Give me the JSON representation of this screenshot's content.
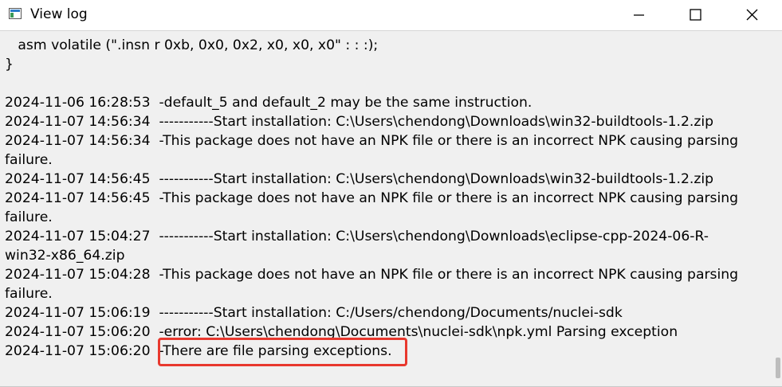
{
  "window": {
    "title": "View log",
    "icons": {
      "app": "window-app-icon",
      "minimize": "minimize-icon",
      "maximize": "maximize-icon",
      "close": "close-icon"
    }
  },
  "log": {
    "lines": [
      "   asm volatile (\".insn r 0xb, 0x0, 0x2, x0, x0, x0\" : : :);",
      "}",
      "",
      "2024-11-06 16:28:53  -default_5 and default_2 may be the same instruction.",
      "2024-11-07 14:56:34  -----------Start installation: C:\\Users\\chendong\\Downloads\\win32-buildtools-1.2.zip",
      "2024-11-07 14:56:34  -This package does not have an NPK file or there is an incorrect NPK causing parsing",
      "failure.",
      "2024-11-07 14:56:45  -----------Start installation: C:\\Users\\chendong\\Downloads\\win32-buildtools-1.2.zip",
      "2024-11-07 14:56:45  -This package does not have an NPK file or there is an incorrect NPK causing parsing",
      "failure.",
      "2024-11-07 15:04:27  -----------Start installation: C:\\Users\\chendong\\Downloads\\eclipse-cpp-2024-06-R-",
      "win32-x86_64.zip",
      "2024-11-07 15:04:28  -This package does not have an NPK file or there is an incorrect NPK causing parsing",
      "failure.",
      "2024-11-07 15:06:19  -----------Start installation: C:/Users/chendong/Documents/nuclei-sdk",
      "2024-11-07 15:06:20  -error: C:\\Users\\chendong\\Documents\\nuclei-sdk\\npk.yml Parsing exception",
      "2024-11-07 15:06:20  -There are file parsing exceptions."
    ]
  },
  "colors": {
    "highlight": "#e8382e",
    "log_background": "#f0f0f0"
  }
}
